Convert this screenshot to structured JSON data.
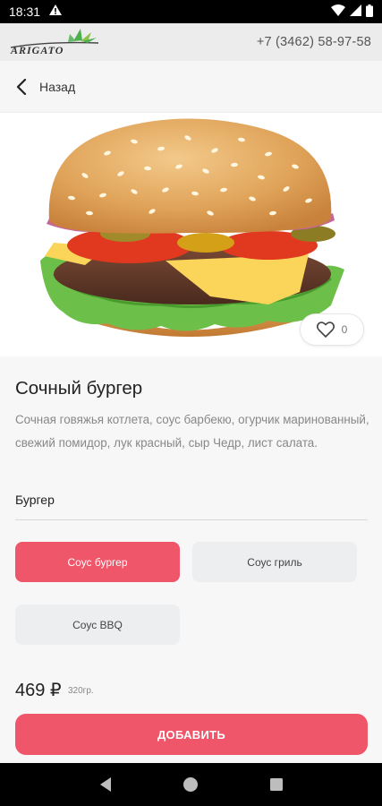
{
  "status_bar": {
    "time": "18:31"
  },
  "header": {
    "logo_text": "ARIGATO",
    "phone": "+7 (3462) 58-97-58"
  },
  "back": {
    "label": "Назад"
  },
  "product": {
    "likes": "0",
    "title": "Сочный бургер",
    "description": "Сочная говяжья котлета, соус барбекю, огурчик маринованный, свежий помидор, лук красный, сыр Чедр, лист салата.",
    "category": "Бургер",
    "options": [
      {
        "label": "Соус бургер",
        "selected": true
      },
      {
        "label": "Соус гриль",
        "selected": false
      },
      {
        "label": "Соус BBQ",
        "selected": false
      }
    ],
    "price": "469 ₽",
    "weight": "320гр.",
    "add_label": "ДОБАВИТЬ"
  },
  "colors": {
    "accent": "#f0566a",
    "option_bg": "#eceef0",
    "header_bg": "#ececec"
  },
  "icons": [
    "warning-icon",
    "wifi-icon",
    "signal-icon",
    "battery-icon",
    "back-arrow-icon",
    "heart-icon",
    "nav-back-icon",
    "nav-home-icon",
    "nav-recents-icon"
  ]
}
